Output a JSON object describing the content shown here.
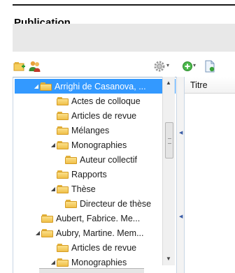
{
  "header": {
    "title": "Publication"
  },
  "toolbar": {
    "icons": [
      "new-folder-icon",
      "users-icon",
      "gear-icon",
      "add-icon",
      "document-icon"
    ]
  },
  "tree": {
    "items": [
      {
        "label": "Arrighi de Casanova, ...",
        "level": 0,
        "expanded": true,
        "selected": true
      },
      {
        "label": "Actes de colloque",
        "level": 1
      },
      {
        "label": "Articles de revue",
        "level": 1
      },
      {
        "label": "Mélanges",
        "level": 1
      },
      {
        "label": "Monographies",
        "level": 1,
        "expanded": true
      },
      {
        "label": "Auteur collectif",
        "level": 2
      },
      {
        "label": "Rapports",
        "level": 1
      },
      {
        "label": "Thèse",
        "level": 1,
        "expanded": true
      },
      {
        "label": "Directeur de thèse",
        "level": 2
      },
      {
        "label": "Aubert, Fabrice. Me...",
        "level": 0
      },
      {
        "label": "Aubry, Martine. Mem...",
        "level": 0,
        "expanded": true
      },
      {
        "label": "Articles de revue",
        "level": 1
      },
      {
        "label": "Monographies",
        "level": 1,
        "expanded": true
      }
    ]
  },
  "grid": {
    "column_header": "Titre"
  },
  "colors": {
    "selection": "#3399ff",
    "folder": "#f0c04a"
  }
}
